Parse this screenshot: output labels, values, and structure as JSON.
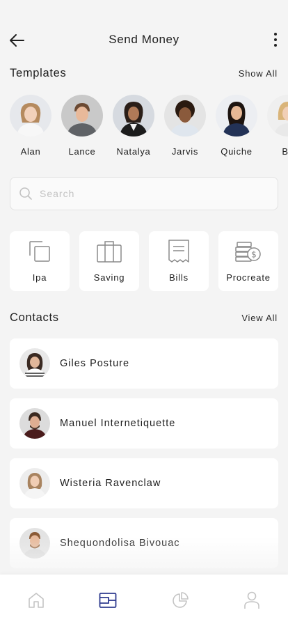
{
  "header": {
    "title": "Send Money",
    "back_icon": "arrow-left-icon",
    "more_icon": "more-vertical-icon"
  },
  "templates": {
    "title": "Templates",
    "link": "Show All",
    "items": [
      {
        "name": "Alan"
      },
      {
        "name": "Lance"
      },
      {
        "name": "Natalya"
      },
      {
        "name": "Jarvis"
      },
      {
        "name": "Quiche"
      },
      {
        "name": "Ba"
      }
    ]
  },
  "search": {
    "placeholder": "Search",
    "value": ""
  },
  "actions": [
    {
      "label": "Ipa",
      "icon": "copy-icon"
    },
    {
      "label": "Saving",
      "icon": "briefcase-icon"
    },
    {
      "label": "Bills",
      "icon": "receipt-icon"
    },
    {
      "label": "Procreate",
      "icon": "coins-dollar-icon"
    }
  ],
  "contacts": {
    "title": "Contacts",
    "link": "View All",
    "items": [
      {
        "name": "Giles Posture"
      },
      {
        "name": "Manuel Internetiquette"
      },
      {
        "name": "Wisteria Ravenclaw"
      },
      {
        "name": "Shequondolisa Bivouac"
      }
    ]
  },
  "tabbar": {
    "items": [
      {
        "icon": "home-icon",
        "active": false
      },
      {
        "icon": "wallet-icon",
        "active": true
      },
      {
        "icon": "pie-chart-icon",
        "active": false
      },
      {
        "icon": "user-icon",
        "active": false
      }
    ],
    "active_color": "#2f3b8f",
    "inactive_color": "#c4c4c4"
  },
  "colors": {
    "background": "#f4f4f4",
    "card": "#ffffff",
    "text": "#1e1e1e"
  }
}
